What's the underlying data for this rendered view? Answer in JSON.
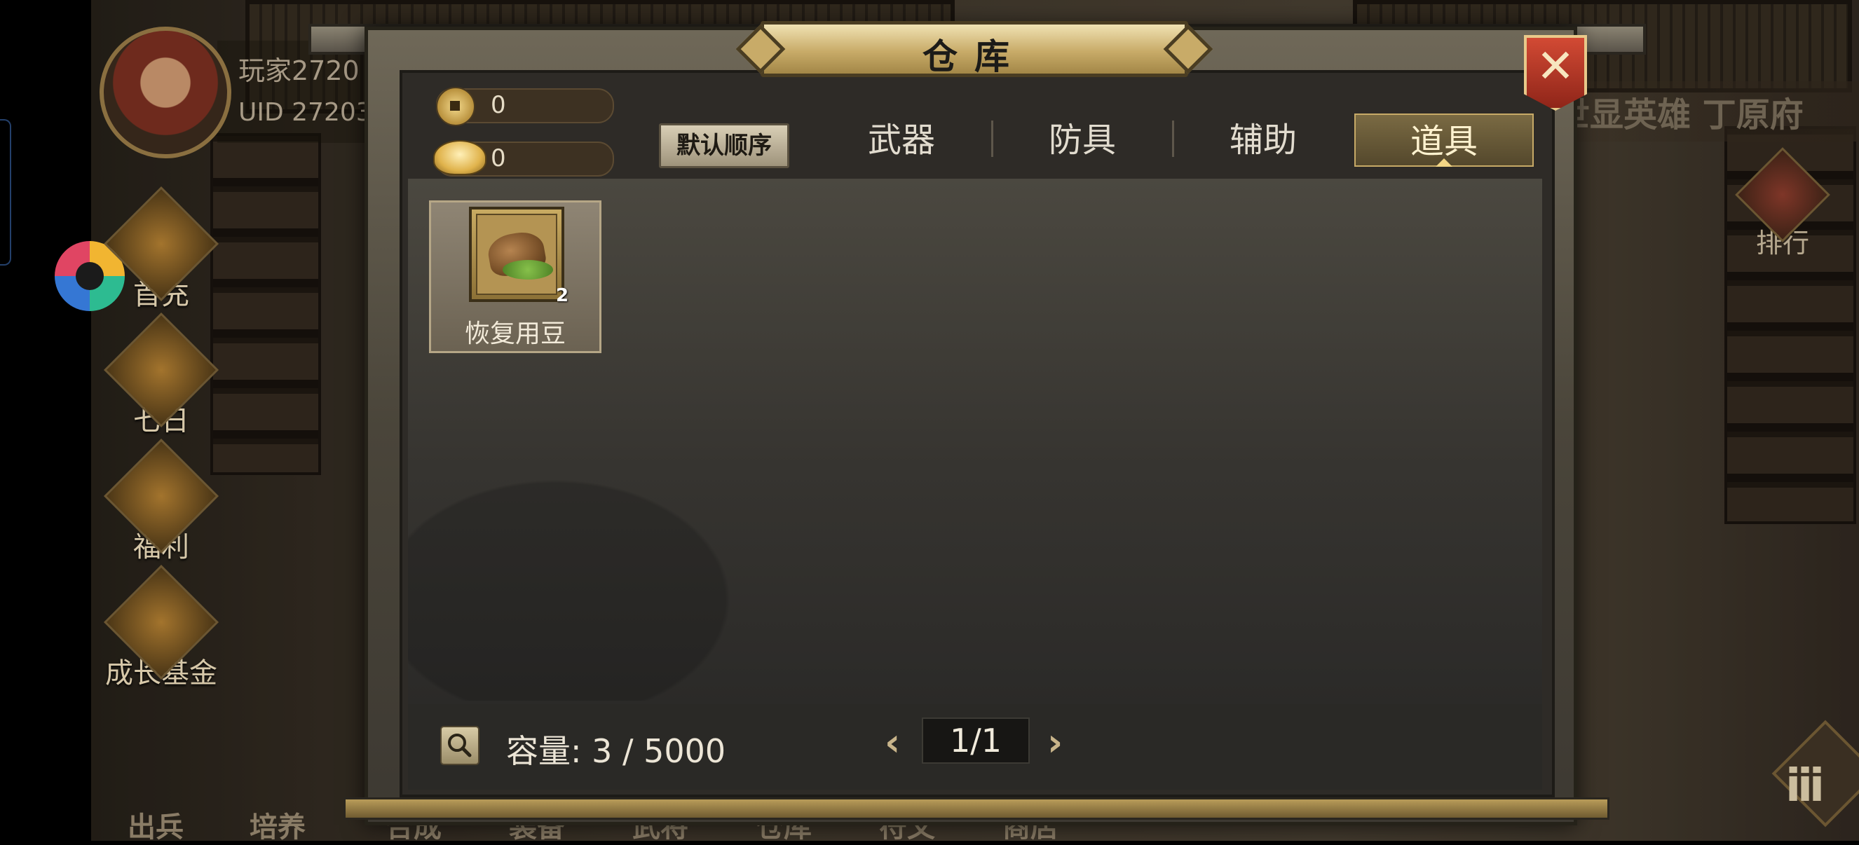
{
  "dialog": {
    "title": "仓库",
    "close_icon": "close-icon"
  },
  "currency": {
    "copper": {
      "icon": "copper-coin-icon",
      "value": "0"
    },
    "gold": {
      "icon": "gold-ingot-icon",
      "value": "0"
    }
  },
  "toolbar": {
    "sort_label": "默认顺序"
  },
  "tabs": [
    {
      "label": "武器",
      "active": false
    },
    {
      "label": "防具",
      "active": false
    },
    {
      "label": "辅助",
      "active": false
    },
    {
      "label": "道具",
      "active": true
    }
  ],
  "items": [
    {
      "name": "恢复用豆",
      "count": "2",
      "icon": "bean-sack-icon"
    }
  ],
  "footer": {
    "capacity_label": "容量:",
    "capacity_value": "3 / 5000",
    "page": "1/1",
    "prev_icon": "‹",
    "next_icon": "›"
  },
  "background": {
    "player_name": "玩家2720",
    "player_uid": "UID  27203",
    "rank_banner": "世显英雄 丁原府",
    "rank_button": "排行",
    "side_buttons": [
      "首充",
      "七日",
      "福利",
      "成长基金"
    ],
    "bottom_nav": [
      "出兵",
      "培养",
      "合成",
      "装备",
      "武将",
      "仓库",
      "符文",
      "商店"
    ]
  },
  "colors": {
    "accent_gold": "#c8ab68",
    "close_red": "#c23b2a",
    "panel_dark": "#2e2b27"
  }
}
